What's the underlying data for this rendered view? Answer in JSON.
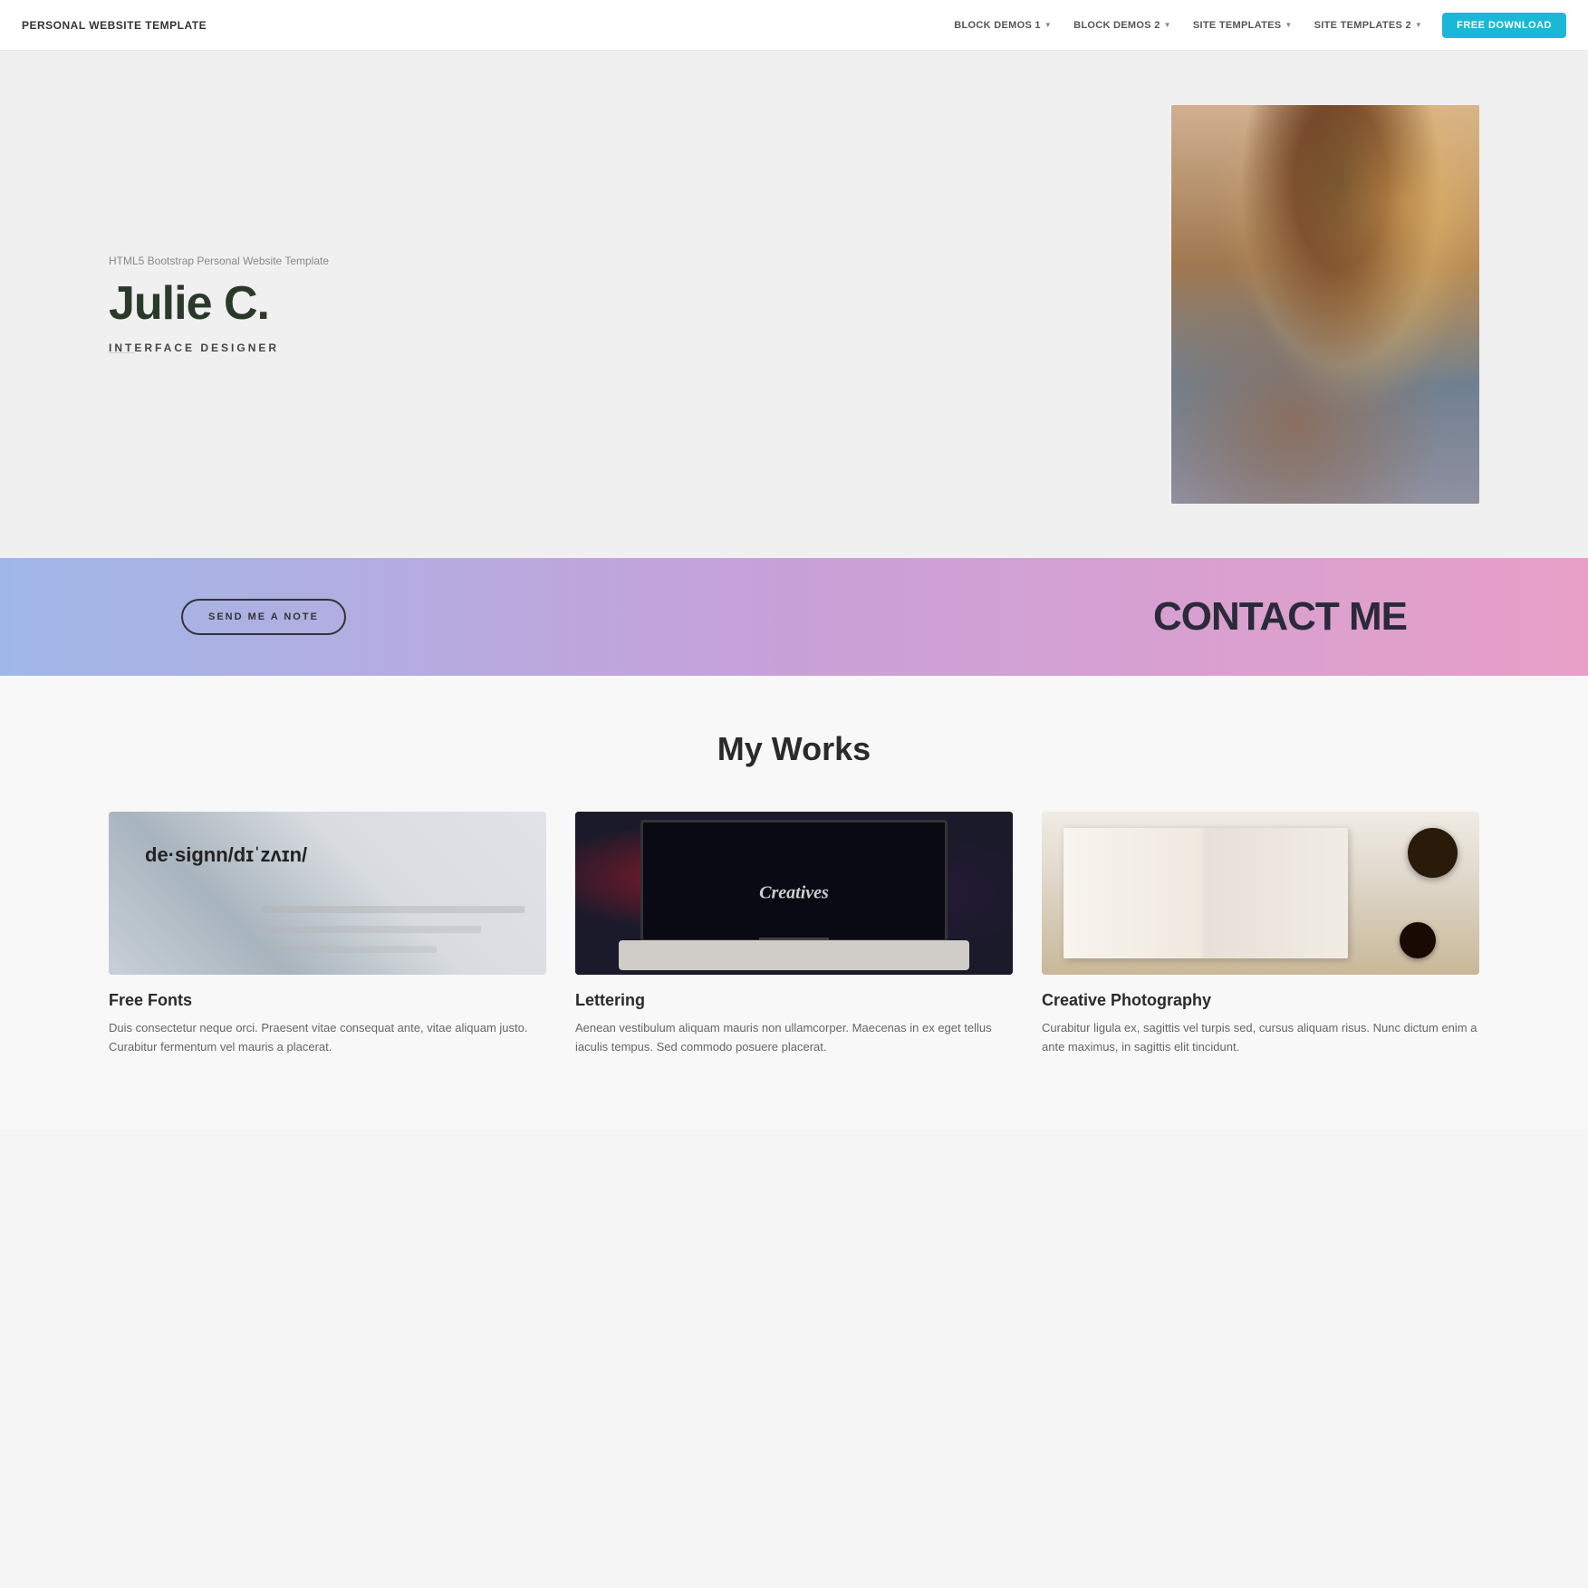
{
  "navbar": {
    "brand": "PERSONAL WEBSITE TEMPLATE",
    "nav_items": [
      {
        "label": "BLOCK DEMOS 1",
        "has_caret": true
      },
      {
        "label": "BLOCK DEMOS 2",
        "has_caret": true
      },
      {
        "label": "SITE TEMPLATES",
        "has_caret": true
      },
      {
        "label": "SITE TEMPLATES 2",
        "has_caret": true
      }
    ],
    "cta_label": "FREE DOWNLOAD"
  },
  "hero": {
    "subtitle": "HTML5 Bootstrap Personal Website Template",
    "name": "Julie C.",
    "role_prefix": "INT",
    "role_suffix": "ERFACE DESIGNER"
  },
  "contact_banner": {
    "button_label": "SEND ME A NOTE",
    "title": "CONTACT ME"
  },
  "works_section": {
    "title": "My Works",
    "cards": [
      {
        "title": "Free Fonts",
        "text": "Duis consectetur neque orci. Praesent vitae consequat ante, vitae aliquam justo. Curabitur fermentum vel mauris a placerat."
      },
      {
        "title": "Lettering",
        "text": "Aenean vestibulum aliquam mauris non ullamcorper. Maecenas in ex eget tellus iaculis tempus. Sed commodo posuere placerat."
      },
      {
        "title": "Creative Photography",
        "text": "Curabitur ligula ex, sagittis vel turpis sed, cursus aliquam risus. Nunc dictum enim a ante maximus, in sagittis elit tincidunt."
      }
    ]
  }
}
